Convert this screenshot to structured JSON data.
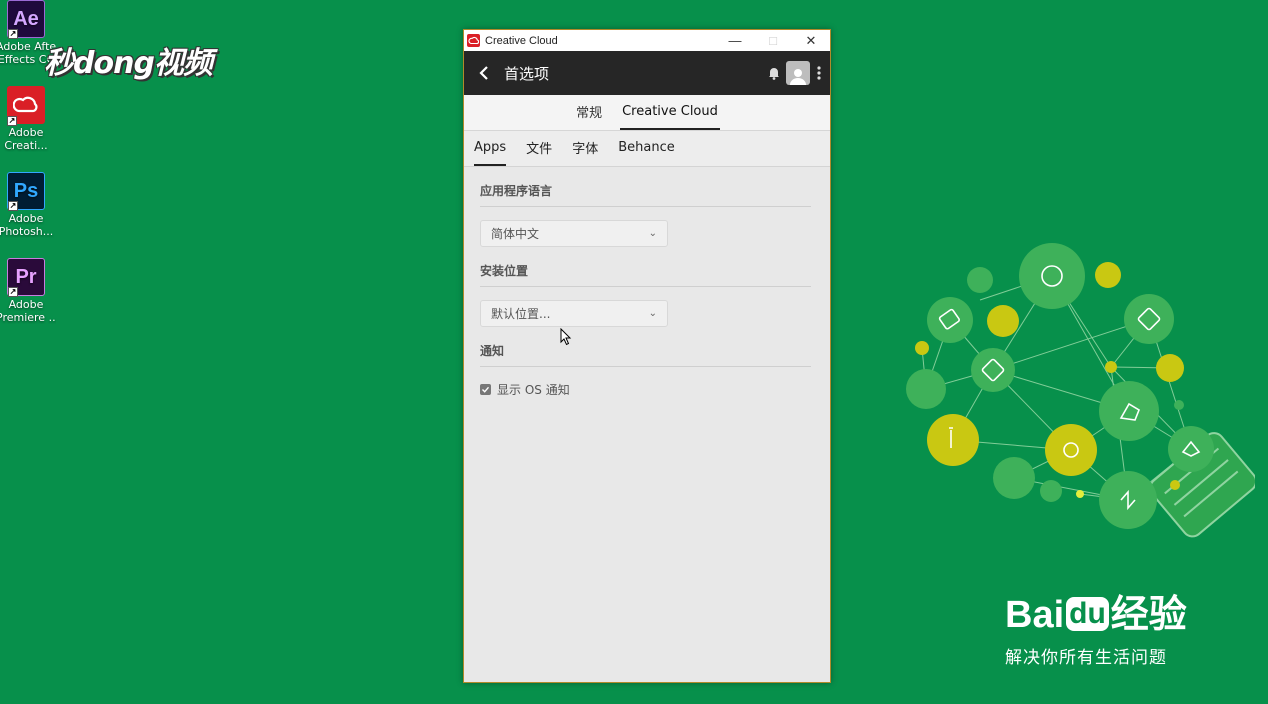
{
  "desktop": {
    "icons": [
      {
        "abbr": "Ae",
        "label1": "Adobe After",
        "label2": "Effects CC",
        "bg": "#1f0a3c",
        "fg": "#d4a6ff"
      },
      {
        "abbr": "",
        "label1": "Adobe",
        "label2": "Creati...",
        "bg": "#da1f26",
        "fg": "#ffffff"
      },
      {
        "abbr": "Ps",
        "label1": "Adobe",
        "label2": "Photosh...",
        "bg": "#001d34",
        "fg": "#31a8ff"
      },
      {
        "abbr": "Pr",
        "label1": "Adobe",
        "label2": "Premiere ...",
        "bg": "#2a0a3a",
        "fg": "#e7a1ff"
      }
    ],
    "watermark_left": "秒dong视频"
  },
  "window": {
    "title": "Creative Cloud",
    "controls": {
      "minimize": "—",
      "maximize": "□",
      "close": "✕"
    }
  },
  "header": {
    "title": "首选项"
  },
  "top_tabs": [
    {
      "label": "常规",
      "active": false
    },
    {
      "label": "Creative Cloud",
      "active": true
    }
  ],
  "sub_tabs": [
    {
      "label": "Apps",
      "active": true
    },
    {
      "label": "文件",
      "active": false
    },
    {
      "label": "字体",
      "active": false
    },
    {
      "label": "Behance",
      "active": false
    }
  ],
  "sections": {
    "language": {
      "title": "应用程序语言",
      "value": "简体中文"
    },
    "install": {
      "title": "安装位置",
      "value": "默认位置..."
    },
    "notify": {
      "title": "通知",
      "checkbox_label": "显示 OS 通知",
      "checked": true
    }
  },
  "baidu": {
    "brand_a": "Bai",
    "brand_b": "du",
    "brand_c": "经验",
    "slogan": "解决你所有生活问题"
  },
  "colors": {
    "desktop_bg": "#07904b",
    "header_bg": "#262626",
    "cc_red": "#da1f26"
  }
}
